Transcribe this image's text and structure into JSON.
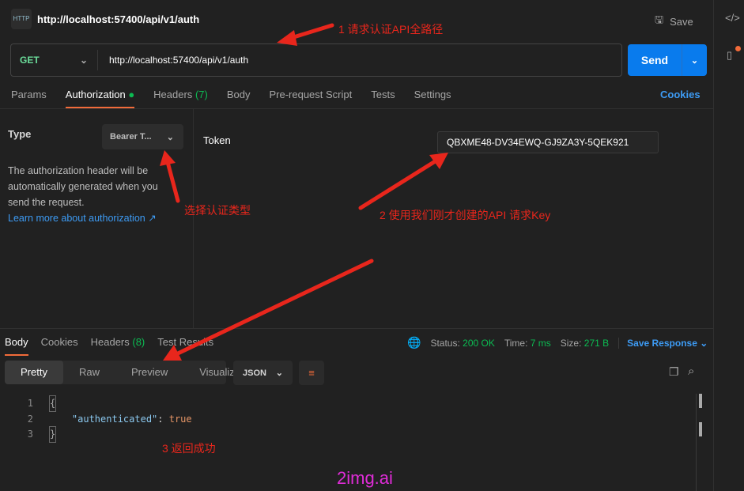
{
  "header": {
    "title": "http://localhost:57400/api/v1/auth",
    "save_label": "Save",
    "http_icon": "HTTP"
  },
  "request": {
    "method": "GET",
    "url": "http://localhost:57400/api/v1/auth",
    "send_label": "Send"
  },
  "tabs": [
    {
      "label": "Params"
    },
    {
      "label": "Authorization",
      "active": true
    },
    {
      "label": "Headers",
      "count": "(7)"
    },
    {
      "label": "Body"
    },
    {
      "label": "Pre-request Script"
    },
    {
      "label": "Tests"
    },
    {
      "label": "Settings"
    }
  ],
  "cookies_label": "Cookies",
  "auth": {
    "type_label": "Type",
    "type_value": "Bearer T...",
    "description": "The authorization header will be automatically generated when you send the request.",
    "learn_more": "Learn more about authorization ↗",
    "token_label": "Token",
    "token_value": "QBXME48-DV34EWQ-GJ9ZA3Y-5QEK921"
  },
  "response": {
    "tabs": [
      {
        "label": "Body"
      },
      {
        "label": "Cookies"
      },
      {
        "label": "Headers",
        "count": "(8)"
      },
      {
        "label": "Test Results"
      }
    ],
    "status_label": "Status:",
    "status": "200 OK",
    "time_label": "Time:",
    "time": "7 ms",
    "size_label": "Size:",
    "size": "271 B",
    "save_response": "Save Response",
    "views": [
      "Pretty",
      "Raw",
      "Preview",
      "Visualize"
    ],
    "format": "JSON",
    "lines": [
      "1",
      "2",
      "3"
    ],
    "key": "\"authenticated\"",
    "value": "true"
  },
  "annotations": {
    "a1": "1 请求认证API全路径",
    "a2": "选择认证类型",
    "a3": "2 使用我们刚才创建的API 请求Key",
    "a4": "3 返回成功",
    "color": "#e8261c"
  },
  "watermark": "2img.ai"
}
